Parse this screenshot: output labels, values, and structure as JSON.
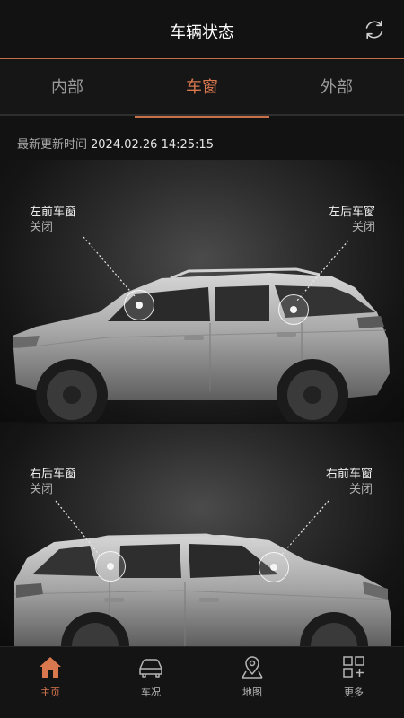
{
  "header": {
    "title": "车辆状态"
  },
  "tabs": [
    {
      "label": "内部"
    },
    {
      "label": "车窗",
      "active": true
    },
    {
      "label": "外部"
    }
  ],
  "update": {
    "label": "最新更新时间",
    "timestamp": "2024.02.26 14:25:15"
  },
  "windows": {
    "front_left": {
      "name": "左前车窗",
      "state": "关闭"
    },
    "rear_left": {
      "name": "左后车窗",
      "state": "关闭"
    },
    "rear_right": {
      "name": "右后车窗",
      "state": "关闭"
    },
    "front_right": {
      "name": "右前车窗",
      "state": "关闭"
    }
  },
  "tabbar": [
    {
      "label": "主页",
      "icon": "home-icon",
      "active": true
    },
    {
      "label": "车况",
      "icon": "car-status-icon"
    },
    {
      "label": "地图",
      "icon": "map-pin-icon"
    },
    {
      "label": "更多",
      "icon": "more-grid-icon"
    }
  ],
  "colors": {
    "accent": "#d9774f",
    "background": "#121212"
  }
}
